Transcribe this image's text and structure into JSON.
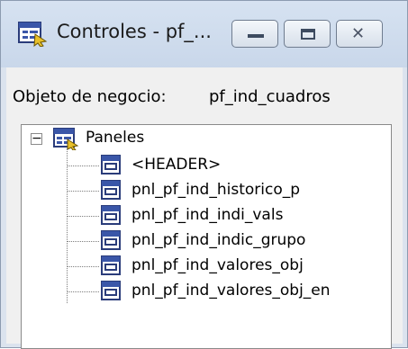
{
  "window": {
    "title": "Controles - pf_...",
    "icons": {
      "app": "panels-form-icon",
      "minimize": "minimize-icon",
      "maximize": "maximize-icon",
      "close": "close-icon"
    },
    "close_glyph": "✕"
  },
  "object": {
    "label": "Objeto de negocio:",
    "value": "pf_ind_cuadros"
  },
  "tree": {
    "expander": "−",
    "root": {
      "label": "Paneles"
    },
    "items": [
      {
        "label": "<HEADER>"
      },
      {
        "label": "pnl_pf_ind_historico_p"
      },
      {
        "label": "pnl_pf_ind_indi_vals"
      },
      {
        "label": "pnl_pf_ind_indic_grupo"
      },
      {
        "label": "pnl_pf_ind_valores_obj"
      },
      {
        "label": "pnl_pf_ind_valores_obj_en"
      }
    ]
  }
}
